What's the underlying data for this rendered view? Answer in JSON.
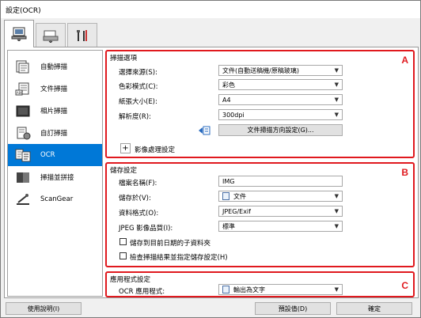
{
  "window": {
    "title": "設定(OCR)"
  },
  "tabs": [
    {
      "name": "scan-from-computer-tab",
      "icon": "computer-scan-icon"
    },
    {
      "name": "scan-from-panel-tab",
      "icon": "scanner-panel-icon"
    },
    {
      "name": "general-settings-tab",
      "icon": "tools-icon"
    }
  ],
  "sidebar": {
    "items": [
      {
        "label": "自動掃描",
        "icon": "auto-scan-icon",
        "active": false
      },
      {
        "label": "文件掃描",
        "icon": "document-scan-icon",
        "active": false
      },
      {
        "label": "相片掃描",
        "icon": "photo-scan-icon",
        "active": false
      },
      {
        "label": "自訂掃描",
        "icon": "custom-scan-icon",
        "active": false
      },
      {
        "label": "OCR",
        "icon": "ocr-icon",
        "active": true
      },
      {
        "label": "掃描並拼接",
        "icon": "scan-stitch-icon",
        "active": false
      },
      {
        "label": "ScanGear",
        "icon": "scangear-icon",
        "active": false
      }
    ]
  },
  "scan_options": {
    "title": "掃描選項",
    "letter": "A",
    "source_label": "選擇來源(S):",
    "source_value": "文件(自動送稿機/原稿玻璃)",
    "color_mode_label": "色彩模式(C):",
    "color_mode_value": "彩色",
    "paper_size_label": "紙張大小(E):",
    "paper_size_value": "A4",
    "resolution_label": "解析度(R):",
    "resolution_value": "300dpi",
    "orientation_button": "文件掃描方向設定(G)...",
    "image_processing_label": "影像處理設定",
    "image_processing_toggle": "+"
  },
  "save_settings": {
    "title": "儲存設定",
    "letter": "B",
    "file_name_label": "檔案名稱(F):",
    "file_name_value": "IMG",
    "save_in_label": "儲存於(V):",
    "save_in_value": "文件",
    "data_format_label": "資料格式(O):",
    "data_format_value": "JPEG/Exif",
    "jpeg_quality_label": "JPEG 影像品質(I):",
    "jpeg_quality_value": "標準",
    "subfolder_checkbox": "儲存到目前日期的子資料夾",
    "subfolder_checked": false,
    "check_results_checkbox": "檢查掃描結果並指定儲存設定(H)",
    "check_results_checked": false
  },
  "app_settings": {
    "title": "應用程式設定",
    "letter": "C",
    "ocr_app_label": "OCR 應用程式:",
    "ocr_app_value": "輸出為文字"
  },
  "footer": {
    "help_button": "使用說明(I)",
    "defaults_button": "預設值(D)",
    "ok_button": "確定"
  },
  "colors": {
    "highlight": "#e0191e",
    "selection": "#0078d7"
  }
}
